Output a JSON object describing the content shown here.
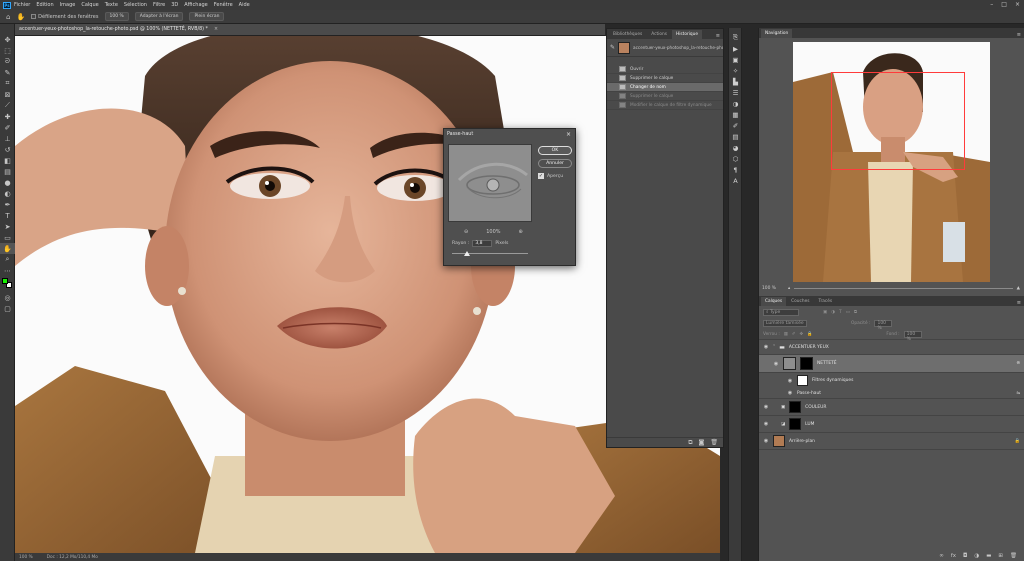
{
  "menubar": {
    "logo": "Ps",
    "items": [
      "Fichier",
      "Edition",
      "Image",
      "Calque",
      "Texte",
      "Sélection",
      "Filtre",
      "3D",
      "Affichage",
      "Fenêtre",
      "Aide"
    ],
    "window_controls": [
      "–",
      "□",
      "×"
    ]
  },
  "options": {
    "scroll_all": "Défilement des fenêtres",
    "zoom": "100 %",
    "fit": "Adapter à l'écran",
    "fill": "Plein écran"
  },
  "document": {
    "tab_title": "accentuer-yeux-photoshop_la-retouche-photo.psd @ 100% (NETTETÉ, RVB/8) *",
    "close": "×"
  },
  "status": {
    "zoom": "100 %",
    "doc": "Doc : 12,2 Mo/110,4 Mo"
  },
  "history": {
    "tabs": [
      "Bibliothèques",
      "Actions",
      "Historique"
    ],
    "snapshot": "accentuer-yeux-photoshop_la-retouche-photo.psd",
    "items": [
      {
        "label": "Ouvrir",
        "state": "normal"
      },
      {
        "label": "Supprimer le calque",
        "state": "normal"
      },
      {
        "label": "Changer de nom",
        "state": "selected"
      },
      {
        "label": "Supprimer le calque",
        "state": "dim"
      },
      {
        "label": "Modifier le calque de filtre dynamique",
        "state": "dim"
      }
    ]
  },
  "dialog": {
    "title": "Passe-haut",
    "ok": "OK",
    "cancel": "Annuler",
    "preview": "Aperçu",
    "zoom": "100%",
    "radius_label": "Rayon :",
    "radius_value": "3,8",
    "unit": "Pixels"
  },
  "navigator": {
    "title": "Navigation",
    "zoom": "100 %"
  },
  "layers_panel": {
    "tabs": [
      "Calques",
      "Couches",
      "Tracés"
    ],
    "kind": "Type",
    "blend_mode": "Lumière tamisée",
    "opacity_label": "Opacité :",
    "opacity": "100 %",
    "lock_label": "Verrou :",
    "fill_label": "Fond :",
    "fill": "100 %"
  },
  "layers": [
    {
      "name": "ACCENTUER YEUX",
      "kind": "group"
    },
    {
      "name": "NETTETÉ",
      "kind": "smart"
    },
    {
      "name": "Filtres dynamiques",
      "kind": "filters"
    },
    {
      "name": "Passe-haut",
      "kind": "filter"
    },
    {
      "name": "COULEUR",
      "kind": "adjust"
    },
    {
      "name": "LUM",
      "kind": "adjust"
    },
    {
      "name": "Arrière-plan",
      "kind": "background"
    }
  ],
  "colors": {
    "accent": "#31a8ff",
    "foreground": "#16f000",
    "nav_box": "#ff3b3b"
  },
  "icons": {
    "tools": [
      "move-icon",
      "marquee-icon",
      "lasso-icon",
      "quick-select-icon",
      "crop-icon",
      "frame-icon",
      "eyedropper-icon",
      "healing-icon",
      "brush-icon",
      "stamp-icon",
      "history-brush-icon",
      "eraser-icon",
      "gradient-icon",
      "blur-icon",
      "dodge-icon",
      "pen-icon",
      "type-icon",
      "path-select-icon",
      "rectangle-icon",
      "hand-icon",
      "zoom-icon",
      "more-icon"
    ]
  }
}
